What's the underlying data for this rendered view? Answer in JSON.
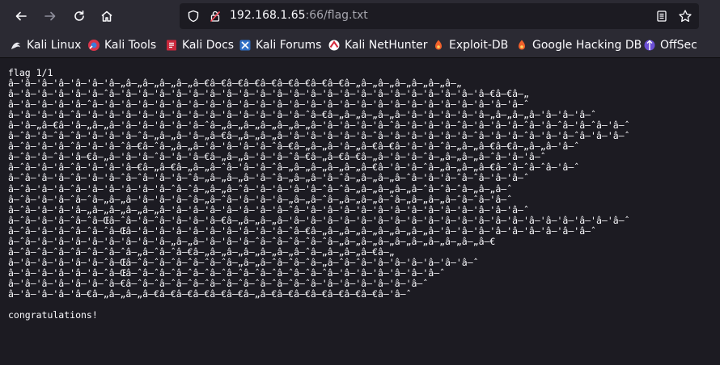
{
  "toolbar": {
    "back_icon": "arrow-left-icon",
    "forward_icon": "arrow-right-icon",
    "reload_icon": "reload-icon",
    "home_icon": "home-icon",
    "url_host": "192.168.1.65",
    "url_rest": ":66/flag.txt",
    "shield_icon": "shield-icon",
    "lock_icon": "insecure-lock-icon",
    "reader_icon": "reader-view-icon",
    "bookmark_star_icon": "star-icon"
  },
  "bookmarks": [
    {
      "label": "Kali Linux",
      "icon": "kali-dragon-icon"
    },
    {
      "label": "Kali Tools",
      "icon": "kali-tools-icon"
    },
    {
      "label": "Kali Docs",
      "icon": "kali-docs-icon"
    },
    {
      "label": "Kali Forums",
      "icon": "kali-forums-icon"
    },
    {
      "label": "Kali NetHunter",
      "icon": "nethunter-icon"
    },
    {
      "label": "Exploit-DB",
      "icon": "exploit-db-icon"
    },
    {
      "label": "Google Hacking DB",
      "icon": "ghdb-icon"
    },
    {
      "label": "OffSec",
      "icon": "offsec-icon"
    }
  ],
  "file": {
    "lines": [
      "flag 1/1",
      "â–'â–'â–'â–'â–'â–'â–„â–„â–„â–„â–„â–€â–€â–€â–€â–€â–€â–€â–€â–€â–„â–„â–„â–„â–„â–„â–„",
      "â–'â–'â–'â–'â–'â–ˆâ–'â–'â–'â–'â–'â–'â–'â–'â–'â–'â–'â–'â–'â–'â–'â–'â–'â–'â–'â–'â–'â–'â–€â–€â–„",
      "â–'â–'â–'â–'â–ˆâ–'â–'â–'â–'â–'â–'â–'â–'â–'â–'â–'â–'â–'â–'â–'â–'â–'â–'â–'â–'â–'â–'â–'â–'â–'â–ˆ",
      "â–'â–'â–'â–ˆâ–'â–'â–'â–'â–'â–'â–'â–'â–'â–'â–'â–'â–'â–ˆâ–€â–„â–„â–„â–„â–'â–'â–'â–'â–'â–„â–„â–„â–'â–'â–'â–ˆ",
      "â–'â–„â–€â–'â–„â–„â–'â–'â–'â–'â–'â–ˆâ–„â–„â–„â–„â–„â–„â–'â–'â–'â–'â–ˆâ–'â–'â–'â–ˆâ–'â–'â–'â–ˆâ–'â–ˆâ–'â–ˆâ–'â–ˆ",
      "â–ˆâ–'â–ˆâ–ˆâ–'â–'â–'â–ˆâ–„â–„â–'â–„â–€â–„â–„â–„â–'â–'â–'â–'â–'â–ˆâ–'â–'â–'â–'â–'â–ˆâ–'â–'â–ˆâ–'â–'â–ˆâ–'â–'â–ˆ",
      "â–ˆâ–'â–'â–ˆâ–'â–'â–ˆâ–€â–ˆâ–„â–„â–'â–'â–'â–'â–ˆâ–€â–„â–„â–'â–„â–€â–€â–'â–'â–ˆâ–„â–„â–€â–€â–„â–„â–'â–ˆ",
      "â–ˆâ–'â–ˆâ–'â–€â–„â–'â–'â–ˆâ–'â–'â–€â–„â–„â–'â–'â–ˆâ–€â–„â–€â–€â–„â–'â–'â–ˆâ–„â–„â–„â–ˆâ–'â–'â–ˆ",
      "â–ˆâ–'â–'â–ˆâ–'â–'â–'â–€â–„â–€â–„â–„â–ˆâ–'â–'â–ˆâ–„â–„â–„â–„â–„â–€â–'â–'â–ˆâ–„â–„â–„â–€â–ˆâ–ˆâ–ˆâ–'â–ˆ",
      "â–ˆâ–'â–'â–ˆâ–'â–'â–ˆâ–ˆâ–'â–'â–ˆâ–„â–„â–„â–'â–ˆâ–„â–„â–'â–ˆâ–„â–„â–„â–ˆâ–'â–'â–ˆâ–ˆâ–'â–'â–ˆ",
      "â–ˆâ–'â–'â–ˆâ–'â–'â–'â–'â–'â–ˆâ–ˆâ–„â–„â–ˆâ–'â–'â–'â–'â–ˆâ–ˆâ–„â–„â–„â–„â–ˆâ–ˆâ–ˆâ–„â–„â–ˆ",
      "â–ˆâ–'â–'â–ˆâ–ˆâ–„â–„â–'â–'â–'â–ˆâ–„â–ˆâ–'â–'â–'â–„â–„â–ˆâ–„â–„â–„â–ˆâ–„â–„â–„â–ˆâ–ˆâ–'â–ˆ",
      "â–ˆâ–'â–'â–'â–„â–„â–„â–„â–„â–'â–'â–'â–'â–'â–'â–'â–ˆâ–'â–'â–'â–'â–'â–'â–'â–'â–'â–'â–'â–'â–'â–ˆ",
      "â–ˆâ–'â–'â–ˆâ–ˆâ–Œâ–ˆâ–'â–ˆâ–'â–'â–'â–€â–„â–„â–„â–'â–'â–'â–'â–'â–'â–'â–'â–'â–'â–'â–'â–'â–'â–'â–'â–'â–'â–'â–'â–ˆ",
      "â–ˆâ–'â–'â–ˆâ–ˆâ–ˆâ–Œâ–'â–'â–'â–'â–'â–'â–'â–'â–'â–ˆâ–€â–„â–„â–„â–„â–„â–„â–„â–'â–'â–'â–'â–'â–'â–'â–'â–'â–ˆ",
      "â–ˆâ–'â–'â–'â–'â–'â–'â–'â–'â–„â–„â–'â–'â–'â–ˆâ–ˆâ–ˆâ–ˆâ–ˆâ–„â–„â–„â–„â–„â–„â–„â–„â–„â–€",
      "â–ˆâ–ˆâ–ˆâ–ˆâ–ˆâ–ˆâ–ˆâ–„â–ˆâ–ˆâ–€â–„â–„â–„â–„â–„â–„â–ˆâ–„â–„â–„â–€â–„",
      "â–'â–'â–'â–'â–'â–ˆâ–Œâ–ˆâ–ˆâ–ˆâ–ˆâ–ˆâ–ˆâ–„â–„â–ˆâ–ˆâ–ˆâ–„â–ˆâ–ˆâ–'â–'â–'â–'â–'â–'â–ˆ",
      "â–'â–'â–'â–'â–'â–ˆâ–Œâ–ˆâ–ˆâ–ˆâ–ˆâ–ˆâ–ˆâ–ˆâ–ˆâ–ˆâ–ˆâ–ˆâ–ˆâ–'â–'â–'â–'â–'â–'â–ˆ",
      "â–'â–'â–'â–'â–'â–ˆâ–€â–ˆâ–ˆâ–ˆâ–ˆâ–ˆâ–ˆâ–ˆâ–ˆâ–ˆâ–ˆâ–ˆâ–'â–'â–'â–'â–'â–'â–ˆ",
      "â–'â–'â–'â–'â–€â–„â–„â–„â–€â–€â–€â–€â–€â–€â–„â–€â–€â–€â–€â–€â–€â–€â–'â–ˆ",
      "",
      "congratulations!"
    ]
  }
}
